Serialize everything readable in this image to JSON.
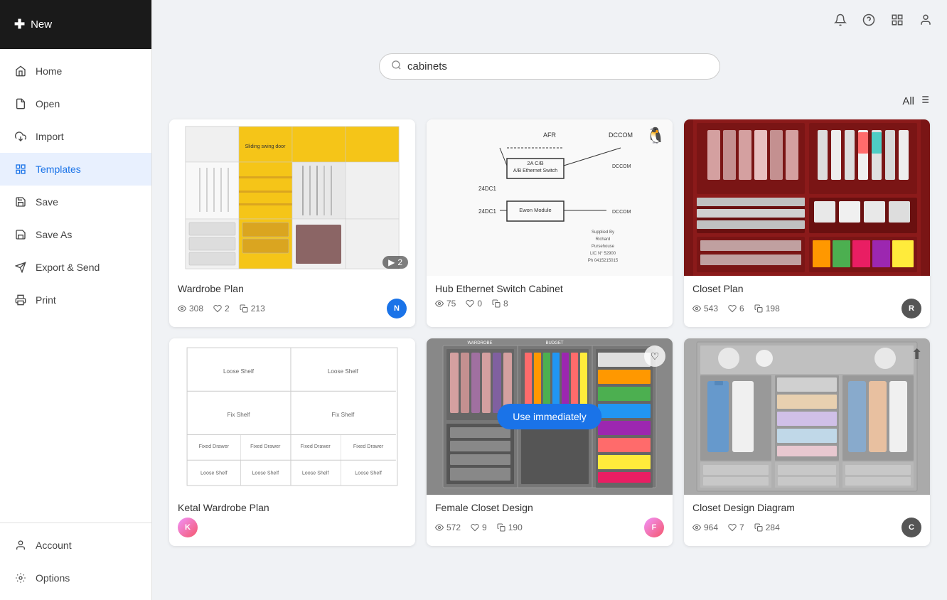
{
  "sidebar": {
    "new_button_label": "New",
    "nav_items": [
      {
        "id": "home",
        "label": "Home",
        "icon": "🏠",
        "active": false
      },
      {
        "id": "open",
        "label": "Open",
        "icon": "📄",
        "active": false
      },
      {
        "id": "import",
        "label": "Import",
        "icon": "📥",
        "active": false
      },
      {
        "id": "templates",
        "label": "Templates",
        "icon": "🖼",
        "active": true
      },
      {
        "id": "save",
        "label": "Save",
        "icon": "💾",
        "active": false
      },
      {
        "id": "save-as",
        "label": "Save As",
        "icon": "📋",
        "active": false
      },
      {
        "id": "export-send",
        "label": "Export & Send",
        "icon": "📤",
        "active": false
      },
      {
        "id": "print",
        "label": "Print",
        "icon": "🖨",
        "active": false
      }
    ],
    "bottom_items": [
      {
        "id": "account",
        "label": "Account",
        "icon": "👤"
      },
      {
        "id": "options",
        "label": "Options",
        "icon": "⚙"
      }
    ]
  },
  "header": {
    "icons": [
      "bell",
      "question",
      "grid",
      "user"
    ]
  },
  "search": {
    "placeholder": "cabinets",
    "value": "cabinets"
  },
  "filter": {
    "label": "All"
  },
  "templates": [
    {
      "id": "wardrobe-plan",
      "title": "Wardrobe Plan",
      "type": "wardrobe",
      "views": "308",
      "likes": "2",
      "copies": "213",
      "avatar_type": "initial",
      "avatar_text": "N",
      "avatar_color": "#1a73e8",
      "has_slide_count": true,
      "slide_count": "2"
    },
    {
      "id": "hub-ethernet",
      "title": "Hub Ethernet Switch Cabinet",
      "type": "network",
      "views": "75",
      "likes": "0",
      "copies": "8",
      "avatar_type": "icon",
      "has_upload_icon": true
    },
    {
      "id": "closet-plan",
      "title": "Closet Plan",
      "type": "closet-photo",
      "views": "543",
      "likes": "6",
      "copies": "198",
      "avatar_type": "photo"
    },
    {
      "id": "ketal-wardrobe",
      "title": "Ketal Wardrobe Plan",
      "type": "ketal",
      "views": "",
      "likes": "",
      "copies": "",
      "avatar_type": "gradient",
      "has_avatar": false
    },
    {
      "id": "female-closet",
      "title": "Female Closet Design",
      "type": "female-closet",
      "views": "572",
      "likes": "9",
      "copies": "190",
      "avatar_type": "gradient",
      "has_heart": true,
      "show_use_btn": true,
      "use_btn_label": "Use immediately"
    },
    {
      "id": "closet-design",
      "title": "Closet Design Diagram",
      "type": "closet-design",
      "views": "964",
      "likes": "7",
      "copies": "284",
      "avatar_type": "photo",
      "has_upload_icon": true
    }
  ]
}
